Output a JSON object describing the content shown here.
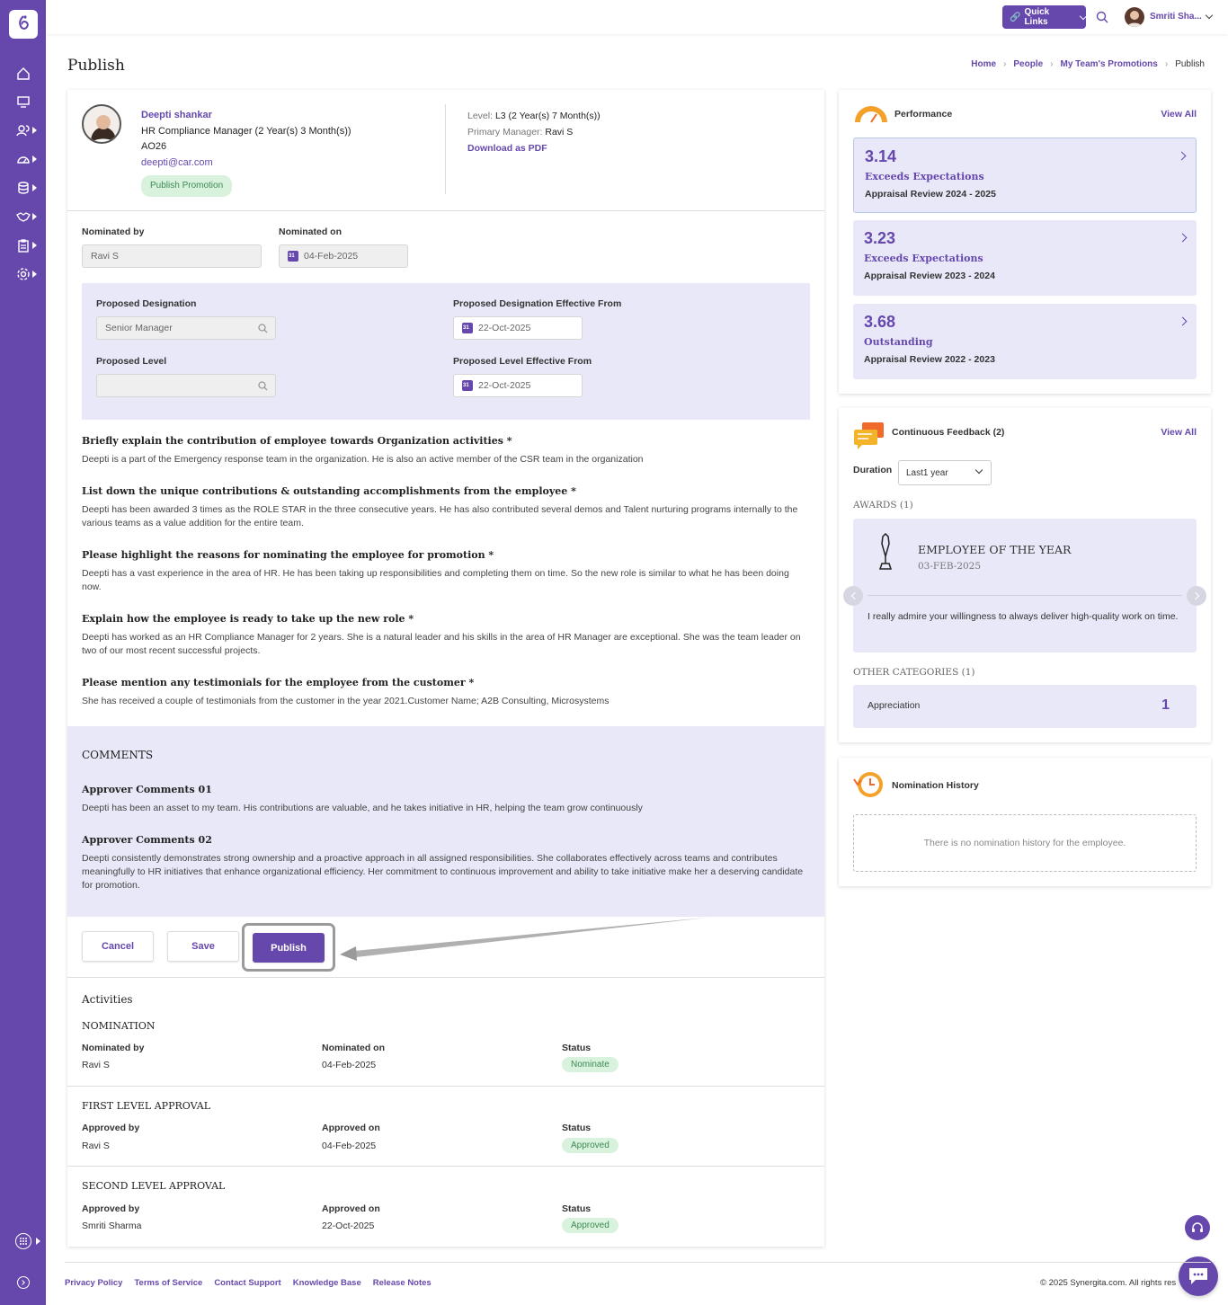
{
  "header": {
    "quick_links": "Quick Links",
    "user_name": "Smriti Sha..."
  },
  "page": {
    "title": "Publish",
    "breadcrumbs": [
      "Home",
      "People",
      "My Team's Promotions",
      "Publish"
    ]
  },
  "employee": {
    "name": "Deepti shankar",
    "role": "HR Compliance Manager (2 Year(s) 3 Month(s))",
    "id": "AO26",
    "email": "deepti@car.com",
    "status": "Publish Promotion",
    "level_label": "Level:",
    "level_value": "L3 (2 Year(s) 7 Month(s))",
    "manager_label": "Primary Manager:",
    "manager_value": "Ravi S",
    "download": "Download as PDF"
  },
  "nomination": {
    "by_label": "Nominated by",
    "by_value": "Ravi S",
    "on_label": "Nominated on",
    "on_value": "04-Feb-2025"
  },
  "proposal": {
    "designation_label": "Proposed Designation",
    "designation_value": "Senior Manager",
    "designation_eff_label": "Proposed Designation Effective From",
    "designation_eff_value": "22-Oct-2025",
    "level_label": "Proposed Level",
    "level_value": "",
    "level_eff_label": "Proposed Level Effective From",
    "level_eff_value": "22-Oct-2025"
  },
  "questions": [
    {
      "q": "Briefly explain the contribution of employee towards Organization activities *",
      "a": "Deepti is a part of the Emergency response team in the organization. He is also an active member of the CSR team in the organization"
    },
    {
      "q": "List down the unique contributions & outstanding accomplishments from the employee *",
      "a": "Deepti has been awarded 3 times as the ROLE STAR in the three consecutive years. He has also contributed several demos and Talent nurturing programs internally to the various teams as a value addition for the entire team."
    },
    {
      "q": "Please highlight the reasons for nominating the employee for promotion *",
      "a": "Deepti has a vast experience in the area of HR. He has been taking up responsibilities and completing them on time. So the new role is similar to what he has been doing now."
    },
    {
      "q": "Explain how the employee is ready to take up the new role *",
      "a": "Deepti has worked as an HR Compliance Manager for 2 years. She is a natural leader and his skills in the area of HR Manager are exceptional. She was the team leader on two of our most recent successful projects."
    },
    {
      "q": "Please mention any testimonials for the employee from the customer *",
      "a": "She has received a couple of testimonials from the customer in the year 2021.Customer Name; A2B Consulting, Microsystems"
    }
  ],
  "comments": {
    "title": "COMMENTS",
    "items": [
      {
        "title": "Approver Comments 01",
        "text": "Deepti has been an asset to my team. His contributions are valuable, and he takes initiative in HR, helping the team grow continuously"
      },
      {
        "title": "Approver Comments 02",
        "text": "Deepti consistently demonstrates strong ownership and a proactive approach in all assigned responsibilities. She collaborates effectively across teams and contributes meaningfully to HR initiatives that enhance organizational efficiency. Her commitment to continuous improvement and ability to take initiative make her a deserving candidate for promotion."
      }
    ]
  },
  "actions": {
    "cancel": "Cancel",
    "save": "Save",
    "publish": "Publish"
  },
  "activities": {
    "title": "Activities",
    "sections": [
      {
        "title": "NOMINATION",
        "c1_label": "Nominated by",
        "c1_value": "Ravi S",
        "c2_label": "Nominated on",
        "c2_value": "04-Feb-2025",
        "c3_label": "Status",
        "c3_value": "Nominate"
      },
      {
        "title": "FIRST LEVEL APPROVAL",
        "c1_label": "Approved by",
        "c1_value": "Ravi S",
        "c2_label": "Approved on",
        "c2_value": "04-Feb-2025",
        "c3_label": "Status",
        "c3_value": "Approved"
      },
      {
        "title": "SECOND LEVEL APPROVAL",
        "c1_label": "Approved by",
        "c1_value": "Smriti Sharma",
        "c2_label": "Approved on",
        "c2_value": "22-Oct-2025",
        "c3_label": "Status",
        "c3_value": "Approved"
      }
    ]
  },
  "performance": {
    "title": "Performance",
    "view_all": "View All",
    "items": [
      {
        "score": "3.14",
        "rating": "Exceeds Expectations",
        "review": "Appraisal Review 2024 - 2025"
      },
      {
        "score": "3.23",
        "rating": "Exceeds Expectations",
        "review": "Appraisal Review 2023 - 2024"
      },
      {
        "score": "3.68",
        "rating": "Outstanding",
        "review": "Appraisal Review 2022 - 2023"
      }
    ]
  },
  "feedback": {
    "title": "Continuous Feedback (2)",
    "view_all": "View All",
    "duration_label": "Duration",
    "duration_value": "Last1 year",
    "awards_title": "AWARDS (1)",
    "award_name": "EMPLOYEE OF THE YEAR",
    "award_date": "03-FEB-2025",
    "award_text": "I really admire your willingness to always deliver high-quality work on time.",
    "other_title": "OTHER CATEGORIES (1)",
    "category": "Appreciation",
    "category_count": "1"
  },
  "history": {
    "title": "Nomination History",
    "empty": "There is no nomination history for the employee."
  },
  "footer": {
    "links": [
      "Privacy Policy",
      "Terms of Service",
      "Contact Support",
      "Knowledge Base",
      "Release Notes"
    ],
    "copyright": "© 2025 Synergita.com. All rights res"
  },
  "colors": {
    "brand": "#6648ad",
    "panel": "#e8e8f8",
    "success_bg": "#d9f2dd"
  }
}
